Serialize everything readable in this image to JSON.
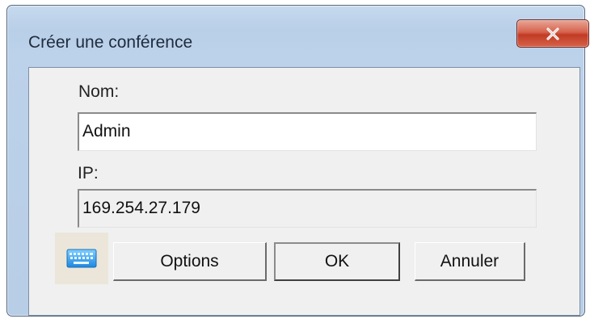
{
  "window": {
    "title": "Créer une conférence",
    "close_icon": "close-x-icon",
    "accent_close_color": "#c8452f"
  },
  "form": {
    "name_label": "Nom:",
    "name_value": "Admin",
    "ip_label": "IP:",
    "ip_value": "169.254.27.179"
  },
  "buttons": {
    "keyboard_icon": "keyboard-icon",
    "options_label": "Options",
    "ok_label": "OK",
    "cancel_label": "Annuler"
  }
}
